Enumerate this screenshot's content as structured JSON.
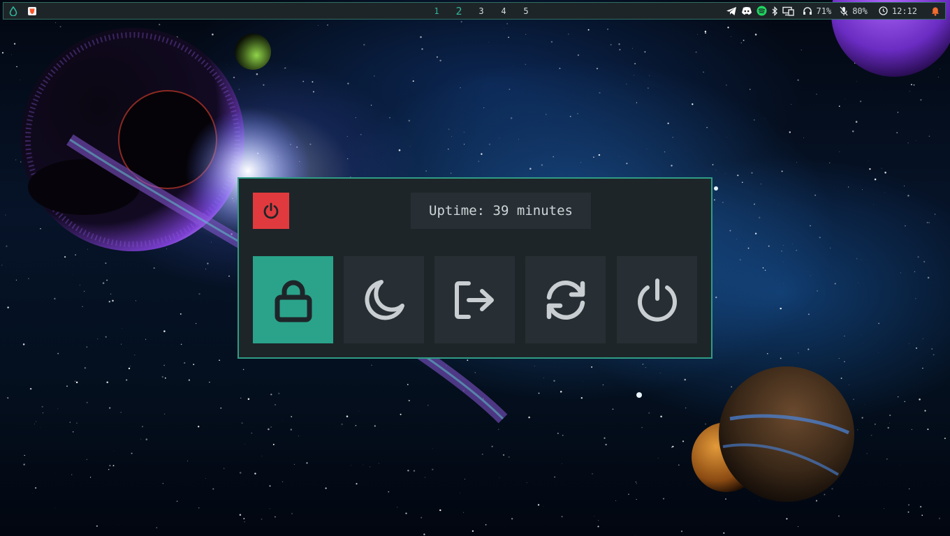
{
  "colors": {
    "accent": "#2aa38a",
    "danger": "#e03a3e",
    "panel": "#1e2529",
    "button": "#272f34",
    "icon": "#c8ced1"
  },
  "topbar": {
    "launcher_icon": "droplet-icon",
    "app_icon": "brave-browser-icon",
    "workspaces": [
      "1",
      "2",
      "3",
      "4",
      "5"
    ],
    "active_workspace": "2",
    "tray_icons": [
      "telegram-icon",
      "discord-icon",
      "spotify-icon",
      "bluetooth-icon",
      "display-icon"
    ],
    "headphone_volume": "71%",
    "mic_volume": "80%",
    "clock": "12:12",
    "notification_icon": "bell-icon"
  },
  "powermenu": {
    "uptime": "Uptime: 39 minutes",
    "header_icon": "power-icon",
    "actions": [
      {
        "name": "lock",
        "icon": "lock-icon",
        "selected": true
      },
      {
        "name": "suspend",
        "icon": "moon-icon",
        "selected": false
      },
      {
        "name": "logout",
        "icon": "logout-icon",
        "selected": false
      },
      {
        "name": "reboot",
        "icon": "reboot-icon",
        "selected": false
      },
      {
        "name": "shutdown",
        "icon": "power-icon",
        "selected": false
      }
    ]
  }
}
